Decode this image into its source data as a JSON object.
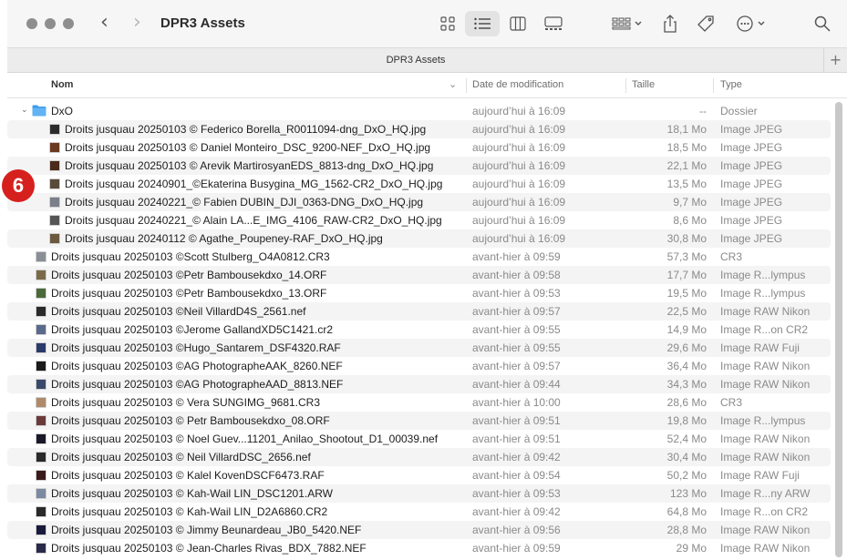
{
  "window": {
    "title": "DPR3 Assets",
    "tab_title": "DPR3 Assets",
    "tab_add": "+"
  },
  "toolbar": {
    "icons": [
      "back-icon",
      "forward-icon",
      "icon-view-icon",
      "list-view-icon",
      "column-view-icon",
      "gallery-view-icon",
      "group-icon",
      "share-icon",
      "tag-icon",
      "more-icon",
      "search-icon"
    ]
  },
  "columns": {
    "name": "Nom",
    "date": "Date de modification",
    "size": "Taille",
    "type": "Type"
  },
  "badge": "6",
  "rows": [
    {
      "name": "DxO",
      "date": "aujourd’hui à 16:09",
      "size": "--",
      "type": "Dossier",
      "kind": "folder",
      "color": "#3d9be9"
    },
    {
      "name": "Droits jusquau 20250103 © Federico Borella_R0011094-dng_DxO_HQ.jpg",
      "date": "aujourd’hui à 16:09",
      "size": "18,1 Mo",
      "type": "Image JPEG",
      "kind": "child",
      "color": "#2c2c2c"
    },
    {
      "name": "Droits jusquau 20250103 © Daniel Monteiro_DSC_9200-NEF_DxO_HQ.jpg",
      "date": "aujourd’hui à 16:09",
      "size": "18,5 Mo",
      "type": "Image JPEG",
      "kind": "child",
      "color": "#6a3a20"
    },
    {
      "name": "Droits jusquau 20250103 © Arevik MartirosyanEDS_8813-dng_DxO_HQ.jpg",
      "date": "aujourd’hui à 16:09",
      "size": "22,1 Mo",
      "type": "Image JPEG",
      "kind": "child",
      "color": "#4a2a1a"
    },
    {
      "name": "Droits jusquau 20240901_©Ekaterina Busygina_MG_1562-CR2_DxO_HQ.jpg",
      "date": "aujourd’hui à 16:09",
      "size": "13,5 Mo",
      "type": "Image JPEG",
      "kind": "child",
      "color": "#5a4a3a"
    },
    {
      "name": "Droits jusquau 20240221_© Fabien DUBIN_DJI_0363-DNG_DxO_HQ.jpg",
      "date": "aujourd’hui à 16:09",
      "size": "9,7 Mo",
      "type": "Image JPEG",
      "kind": "child",
      "color": "#7a7f88"
    },
    {
      "name": "Droits jusquau 20240221_© Alain LA...E_IMG_4106_RAW-CR2_DxO_HQ.jpg",
      "date": "aujourd’hui à 16:09",
      "size": "8,6 Mo",
      "type": "Image JPEG",
      "kind": "child",
      "color": "#555555"
    },
    {
      "name": "Droits jusquau 20240112 © Agathe_Poupeney-RAF_DxO_HQ.jpg",
      "date": "aujourd’hui à 16:09",
      "size": "30,8 Mo",
      "type": "Image JPEG",
      "kind": "child",
      "color": "#6b5a40"
    },
    {
      "name": "Droits jusquau 20250103 ©Scott Stulberg_O4A0812.CR3",
      "date": "avant-hier à 09:59",
      "size": "57,3 Mo",
      "type": "CR3",
      "kind": "file",
      "color": "#8a8f96"
    },
    {
      "name": "Droits jusquau 20250103 ©Petr Bambousekdxo_14.ORF",
      "date": "avant-hier à 09:58",
      "size": "17,7 Mo",
      "type": "Image R...lympus",
      "kind": "file",
      "color": "#7a6a4a"
    },
    {
      "name": "Droits jusquau 20250103 ©Petr Bambousekdxo_13.ORF",
      "date": "avant-hier à 09:53",
      "size": "19,5 Mo",
      "type": "Image R...lympus",
      "kind": "file",
      "color": "#4a6a3a"
    },
    {
      "name": "Droits jusquau 20250103 ©Neil VillardD4S_2561.nef",
      "date": "avant-hier à 09:57",
      "size": "22,5 Mo",
      "type": "Image RAW Nikon",
      "kind": "file",
      "color": "#2a2a2a"
    },
    {
      "name": "Droits jusquau 20250103 ©Jerome GallandXD5C1421.cr2",
      "date": "avant-hier à 09:55",
      "size": "14,9 Mo",
      "type": "Image R...on CR2",
      "kind": "file",
      "color": "#5a6a8a"
    },
    {
      "name": "Droits jusquau 20250103 ©Hugo_Santarem_DSF4320.RAF",
      "date": "avant-hier à 09:55",
      "size": "29,6 Mo",
      "type": "Image RAW Fuji",
      "kind": "file",
      "color": "#2a3a6a"
    },
    {
      "name": "Droits jusquau 20250103 ©AG PhotographeAAK_8260.NEF",
      "date": "avant-hier à 09:57",
      "size": "36,4 Mo",
      "type": "Image RAW Nikon",
      "kind": "file",
      "color": "#1a1a1a"
    },
    {
      "name": "Droits jusquau 20250103 ©AG PhotographeAAD_8813.NEF",
      "date": "avant-hier à 09:44",
      "size": "34,3 Mo",
      "type": "Image RAW Nikon",
      "kind": "file",
      "color": "#3a4a6a"
    },
    {
      "name": "Droits jusquau 20250103 © Vera SUNGIMG_9681.CR3",
      "date": "avant-hier à 10:00",
      "size": "28,6 Mo",
      "type": "CR3",
      "kind": "file",
      "color": "#b08a6a"
    },
    {
      "name": "Droits jusquau 20250103 © Petr Bambousekdxo_08.ORF",
      "date": "avant-hier à 09:51",
      "size": "19,8 Mo",
      "type": "Image R...lympus",
      "kind": "file",
      "color": "#6a3a3a"
    },
    {
      "name": "Droits jusquau 20250103 © Noel Guev...11201_Anilao_Shootout_D1_00039.nef",
      "date": "avant-hier à 09:51",
      "size": "52,4 Mo",
      "type": "Image RAW Nikon",
      "kind": "file",
      "color": "#1a1a2a"
    },
    {
      "name": "Droits jusquau 20250103 © Neil VillardDSC_2656.nef",
      "date": "avant-hier à 09:42",
      "size": "30,4 Mo",
      "type": "Image RAW Nikon",
      "kind": "file",
      "color": "#2a2a2a"
    },
    {
      "name": "Droits jusquau 20250103 © Kalel KovenDSCF6473.RAF",
      "date": "avant-hier à 09:54",
      "size": "50,2 Mo",
      "type": "Image RAW Fuji",
      "kind": "file",
      "color": "#3a1a1a"
    },
    {
      "name": "Droits jusquau 20250103 © Kah-Wail LIN_DSC1201.ARW",
      "date": "avant-hier à 09:53",
      "size": "123 Mo",
      "type": "Image R...ny ARW",
      "kind": "file",
      "color": "#7a8aa0"
    },
    {
      "name": "Droits jusquau 20250103 © Kah-Wail LIN_D2A6860.CR2",
      "date": "avant-hier à 09:42",
      "size": "64,8 Mo",
      "type": "Image R...on CR2",
      "kind": "file",
      "color": "#2a2a2a"
    },
    {
      "name": "Droits jusquau 20250103 © Jimmy Beunardeau_JB0_5420.NEF",
      "date": "avant-hier à 09:56",
      "size": "28,8 Mo",
      "type": "Image RAW Nikon",
      "kind": "file",
      "color": "#1a1a3a"
    },
    {
      "name": "Droits jusquau 20250103 © Jean-Charles Rivas_BDX_7882.NEF",
      "date": "avant-hier à 09:59",
      "size": "29 Mo",
      "type": "Image RAW Nikon",
      "kind": "file",
      "color": "#2a2a4a"
    }
  ]
}
